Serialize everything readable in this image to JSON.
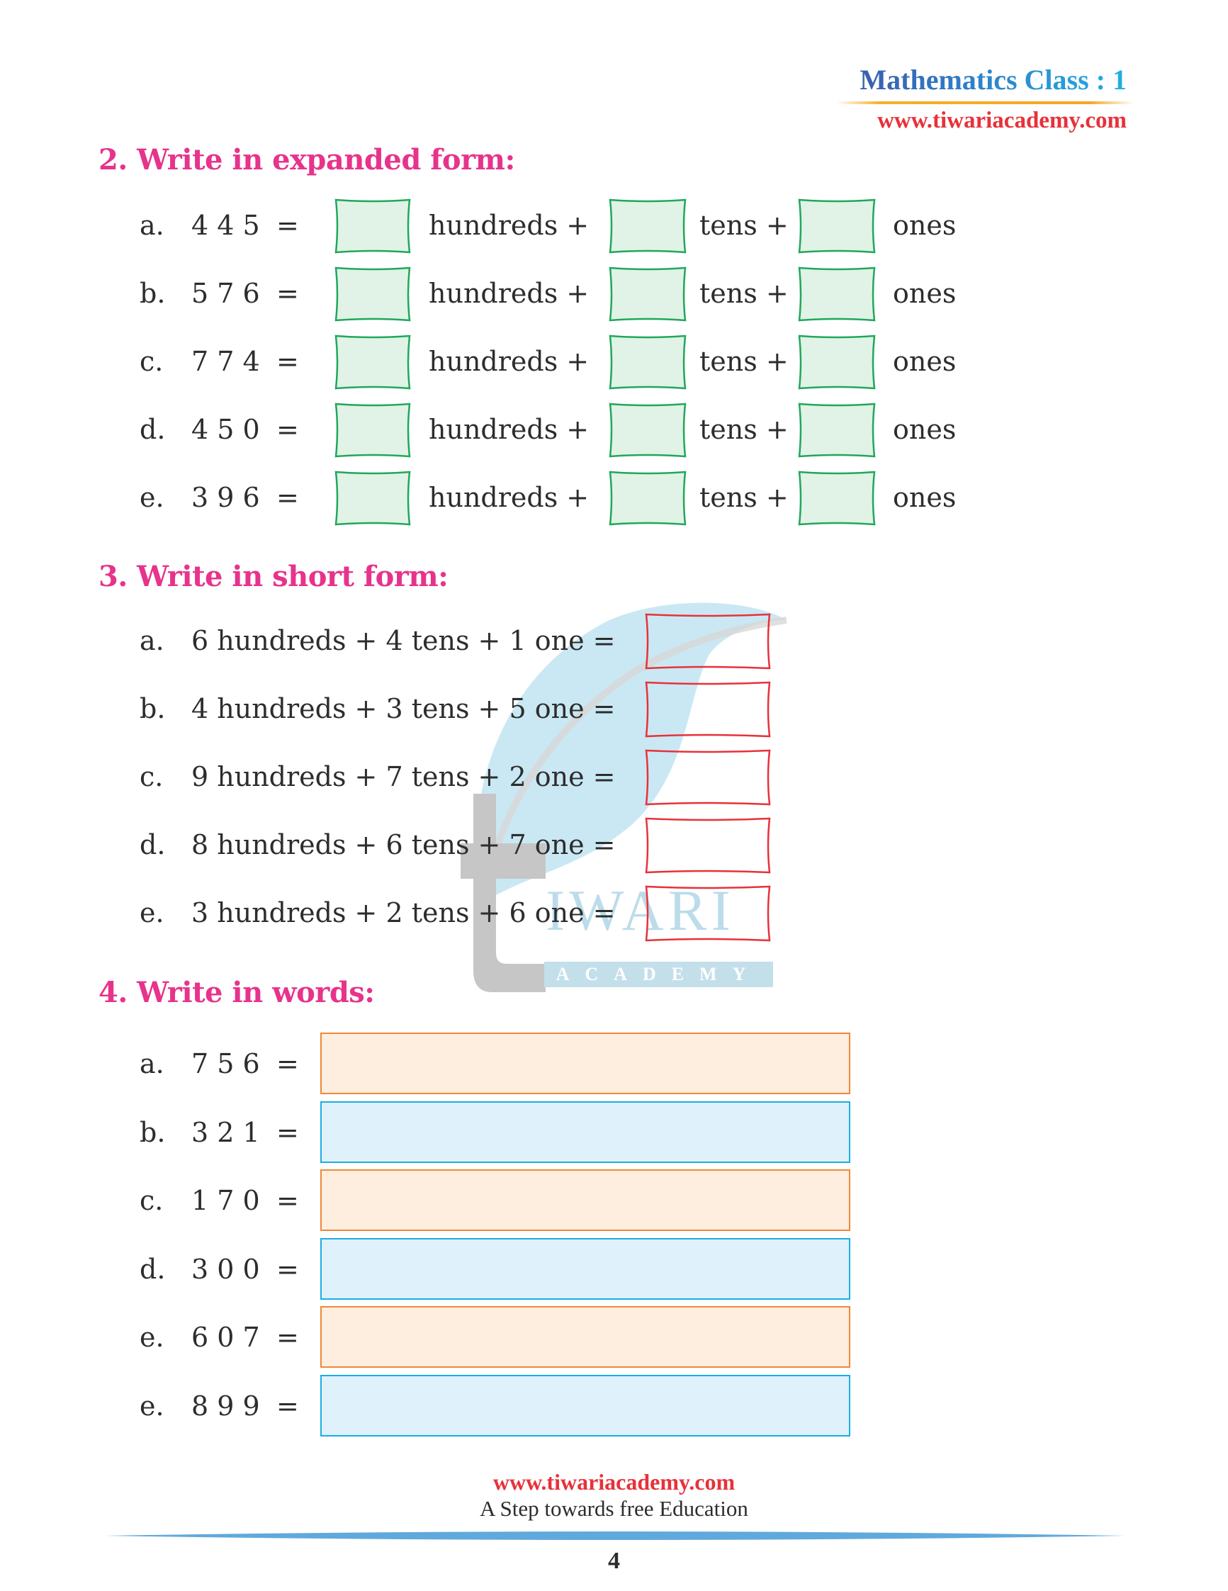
{
  "header": {
    "title": "Mathematics Class : 1",
    "url": "www.tiwariacademy.com"
  },
  "colors": {
    "heading": "#e7338b",
    "expanded_box_border": "#1fa85a",
    "expanded_box_fill": "#e1f2e7",
    "short_box_border": "#e8313a",
    "words_box_orange_border": "#f0883a",
    "words_box_orange_fill": "#fdeedf",
    "words_box_blue_border": "#1aaee3",
    "words_box_blue_fill": "#dff1fb",
    "header_url": "#e8313a"
  },
  "sections": {
    "expanded": {
      "heading": "2.  Write in expanded form:",
      "unit_hundreds": "hundreds +",
      "unit_tens": "tens +",
      "unit_ones": "ones",
      "rows": [
        {
          "label": "a.",
          "number": "4 4 5",
          "eq": "="
        },
        {
          "label": "b.",
          "number": "5 7 6",
          "eq": "="
        },
        {
          "label": "c.",
          "number": "7 7 4",
          "eq": "="
        },
        {
          "label": "d.",
          "number": "4 5 0",
          "eq": "="
        },
        {
          "label": "e.",
          "number": "3 9 6",
          "eq": "="
        }
      ]
    },
    "short": {
      "heading": "3.  Write in short form:",
      "rows": [
        {
          "label": "a.",
          "expr": "6 hundreds + 4 tens + 1 one ="
        },
        {
          "label": "b.",
          "expr": "4 hundreds + 3 tens + 5 one ="
        },
        {
          "label": "c.",
          "expr": "9 hundreds + 7 tens + 2 one ="
        },
        {
          "label": "d.",
          "expr": "8 hundreds + 6 tens + 7 one ="
        },
        {
          "label": "e.",
          "expr": "3 hundreds + 2 tens + 6 one ="
        }
      ]
    },
    "words": {
      "heading": "4.  Write in words:",
      "rows": [
        {
          "label": "a.",
          "number": "7 5 6",
          "eq": "=",
          "style": "orange"
        },
        {
          "label": "b.",
          "number": "3 2 1",
          "eq": "=",
          "style": "blue"
        },
        {
          "label": "c.",
          "number": "1 7 0",
          "eq": "=",
          "style": "orange"
        },
        {
          "label": "d.",
          "number": "3 0 0",
          "eq": "=",
          "style": "blue"
        },
        {
          "label": "e.",
          "number": "6 0 7",
          "eq": "=",
          "style": "orange"
        },
        {
          "label": "e.",
          "number": "8 9 9",
          "eq": "=",
          "style": "blue"
        }
      ]
    }
  },
  "watermark": {
    "brand": "IWARI",
    "sub": "ACADEMY"
  },
  "footer": {
    "url": "www.tiwariacademy.com",
    "tagline": "A Step towards free Education",
    "page_number": "4"
  }
}
